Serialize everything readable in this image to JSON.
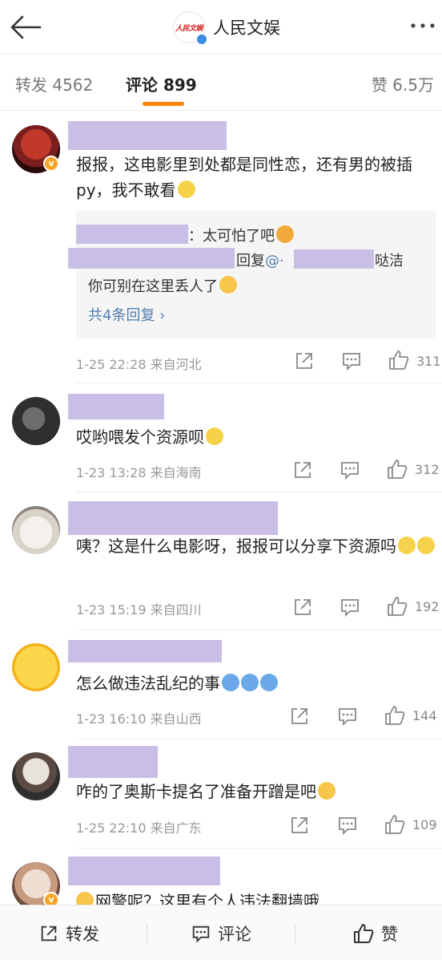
{
  "header": {
    "title": "人民文娱",
    "logo_text": "人民文娱"
  },
  "tabs": {
    "repost": "转发 4562",
    "comments": "评论 899",
    "likes": "赞 6.5万"
  },
  "comments": [
    {
      "text": "报报，这电影里到处都是同性恋，还有男的被插py，我不敢看",
      "replies": {
        "line1_text": "：太可怕了吧",
        "line2_prefix": "回复",
        "line2_mention": "@·",
        "line2_suffix": "哒洁",
        "line3_text": "你可别在这里丢人了",
        "more": "共4条回复 ›"
      },
      "meta": "1-25 22:28  来自河北",
      "likes": "311"
    },
    {
      "text": "哎哟喂发个资源呗",
      "meta": "1-23 13:28  来自海南",
      "likes": "312"
    },
    {
      "text": "咦？这是什么电影呀，报报可以分享下资源吗",
      "meta": "1-23 15:19  来自四川",
      "likes": "192"
    },
    {
      "text": "怎么做违法乱纪的事",
      "meta": "1-23 16:10  来自山西",
      "likes": "144"
    },
    {
      "text": "咋的了奥斯卡提名了准备开蹭是吧",
      "meta": "1-25 22:10  来自广东",
      "likes": "109"
    },
    {
      "text": "网警呢？这里有个人违法翻墙哦"
    }
  ],
  "bottom_bar": {
    "repost": "转发",
    "comment": "评论",
    "like": "赞"
  },
  "colors": {
    "accent": "#ff8200",
    "link": "#507daf",
    "redaction": "#c9bfe6"
  }
}
